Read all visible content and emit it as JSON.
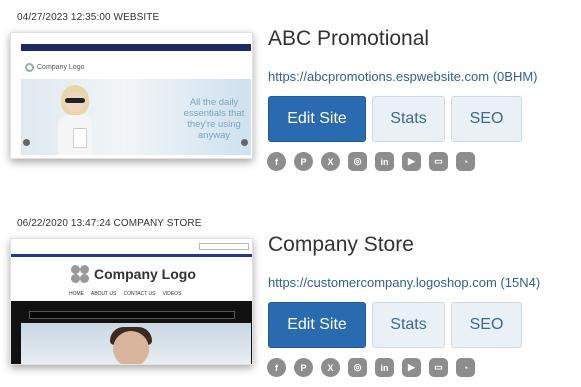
{
  "sites": [
    {
      "meta": "04/27/2023 12:35:00 WEBSITE",
      "title": "ABC Promotional",
      "url": "https://abcpromotions.espwebsite.com (0BHM)",
      "buttons": {
        "edit": "Edit Site",
        "stats": "Stats",
        "seo": "SEO"
      },
      "thumbnail": {
        "logo": "Company Logo",
        "tagline": "All the daily essentials that they're using anyway"
      }
    },
    {
      "meta": "06/22/2020 13:47:24 COMPANY STORE",
      "title": "Company Store",
      "url": "https://customercompany.logoshop.com (15N4)",
      "buttons": {
        "edit": "Edit Site",
        "stats": "Stats",
        "seo": "SEO"
      },
      "thumbnail": {
        "logo": "Company Logo",
        "menu": [
          "HOME",
          "ABOUT US",
          "CONTACT US",
          "VIDEOS"
        ]
      }
    }
  ],
  "social_icons": [
    "facebook-icon",
    "pinterest-icon",
    "x-icon",
    "instagram-icon",
    "linkedin-icon",
    "youtube-icon",
    "blogger-icon",
    "rss-icon"
  ],
  "colors": {
    "primary_button": "#2a6bb0",
    "secondary_button": "#e9f0f6",
    "link": "#2e5f97",
    "social_icon": "#8d8d8d"
  }
}
